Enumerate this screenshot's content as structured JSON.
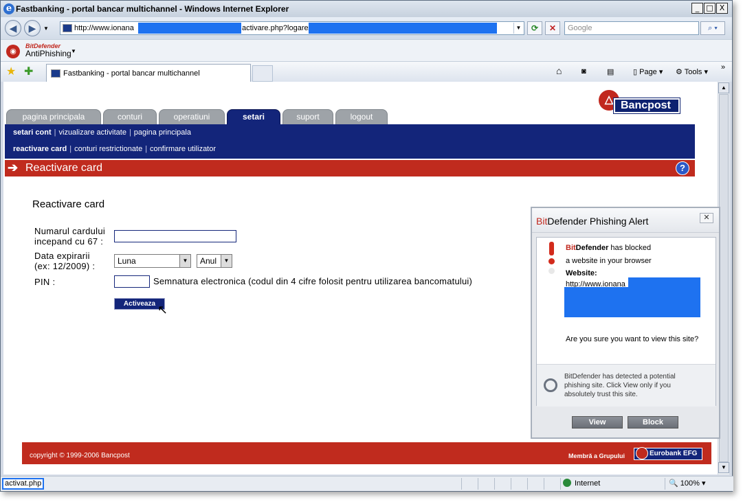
{
  "window": {
    "title": "Fastbanking - portal bancar multichannel - Windows Internet Explorer",
    "controls": {
      "minimize": "_",
      "maximize": "□",
      "close": "X"
    }
  },
  "address_bar": {
    "url_start": "http://www.ionana",
    "url_mid": "activare.php?logare/",
    "search_placeholder": "Google",
    "mask_color": "#1e72f0"
  },
  "toolbar": {
    "brand": "BitDefender",
    "product": "AntiPhishing"
  },
  "tab": {
    "label": "Fastbanking - portal bancar multichannel"
  },
  "command_bar": {
    "page_label": "Page",
    "tools_label": "Tools"
  },
  "bank": {
    "logo_text": "Bancpost",
    "tabs": [
      "pagina principala",
      "conturi",
      "operatiuni",
      "setari",
      "suport",
      "logout"
    ],
    "active_tab": "setari",
    "subnav_row1": [
      "setari cont",
      "vizualizare activitate",
      "pagina principala"
    ],
    "subnav_row2": [
      "reactivare card",
      "conturi restrictionate",
      "confirmare utilizator"
    ],
    "page_header": "Reactivare card",
    "help": "?",
    "colors": {
      "navy": "#13257a",
      "red": "#c02b1e",
      "tab_gray": "#9ea3a8"
    }
  },
  "form": {
    "title": "Reactivare card",
    "card_label_1": "Numarul cardului",
    "card_label_2": "incepand cu 67 :",
    "expiry_label_1": "Data expirarii",
    "expiry_label_2": "(ex: 12/2009) :",
    "month_value": "Luna",
    "year_value": "Anul",
    "pin_label": "PIN :",
    "pin_hint": "Semnatura electronica (codul din 4 cifre folosit pentru utilizarea bancomatului)",
    "submit": "Activeaza"
  },
  "footer": {
    "copyright": "copyright © 1999-2006 Bancpost",
    "member": "Membră a Grupului",
    "group": "Eurobank EFG"
  },
  "alert": {
    "title_brand": "Bit",
    "title_rest": "Defender Phishing Alert",
    "line1_brand_red": "Bit",
    "line1_brand": "Defender",
    "line1_rest": " has blocked",
    "line2": "a website in your browser",
    "website_label": "Website:",
    "website_value": "http://www.ionana",
    "question": "Are you sure you want to view this site?",
    "info": "BitDefender has detected a potential phishing site. Click View only if you absolutely trust this site.",
    "view_button": "View",
    "block_button": "Block",
    "close": "✕"
  },
  "status_bar": {
    "message": "activat.php",
    "zone": "Internet",
    "zoom": "100%"
  }
}
